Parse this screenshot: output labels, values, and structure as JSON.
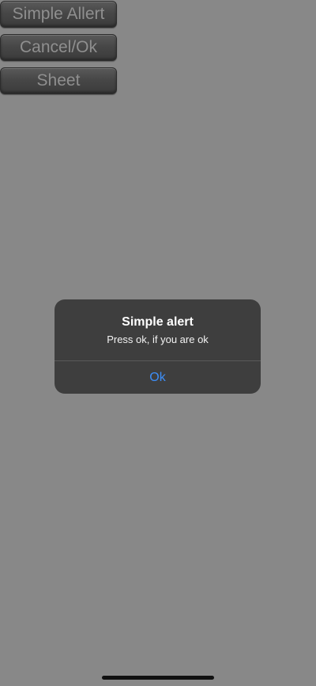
{
  "buttons": {
    "simple_alert": "Simple Allert",
    "cancel_ok": "Cancel/Ok",
    "sheet": "Sheet"
  },
  "alert": {
    "title": "Simple alert",
    "message": "Press ok, if you are ok",
    "ok_label": "Ok"
  },
  "colors": {
    "background": "#888888",
    "alert_background": "#3e3e3e",
    "action_blue": "#3d8ef7"
  }
}
